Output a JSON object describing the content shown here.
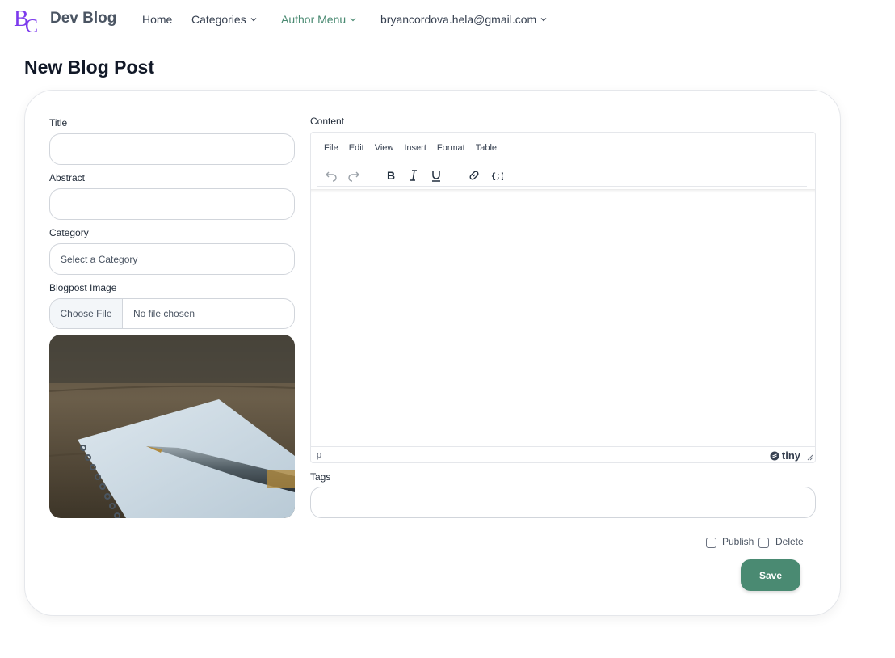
{
  "navbar": {
    "brand": "Dev Blog",
    "logo_text": "BC",
    "logo_color": "#7c3aed",
    "links": [
      {
        "label": "Home",
        "has_dropdown": false
      },
      {
        "label": "Categories",
        "has_dropdown": true
      },
      {
        "label": "Author Menu",
        "has_dropdown": true,
        "active": true
      },
      {
        "label": "bryancordova.hela@gmail.com",
        "has_dropdown": true
      }
    ]
  },
  "page": {
    "title": "New Blog Post"
  },
  "form": {
    "title_label": "Title",
    "title_value": "",
    "abstract_label": "Abstract",
    "abstract_value": "",
    "category_label": "Category",
    "category_placeholder": "Select a Category",
    "image_label": "Blogpost Image",
    "file_button": "Choose File",
    "file_status": "No file chosen",
    "content_label": "Content",
    "tags_label": "Tags",
    "tags_value": "",
    "publish_label": "Publish",
    "publish_checked": false,
    "delete_label": "Delete",
    "delete_checked": false,
    "save_label": "Save"
  },
  "editor": {
    "menus": [
      "File",
      "Edit",
      "View",
      "Insert",
      "Format",
      "Table"
    ],
    "toolbar": [
      "undo-icon",
      "redo-icon",
      "bold-icon",
      "italic-icon",
      "underline-icon",
      "link-icon",
      "code-icon"
    ],
    "status_path": "p",
    "brand": "tiny"
  },
  "colors": {
    "accent": "#4a8a72",
    "logo": "#7c3aed"
  }
}
